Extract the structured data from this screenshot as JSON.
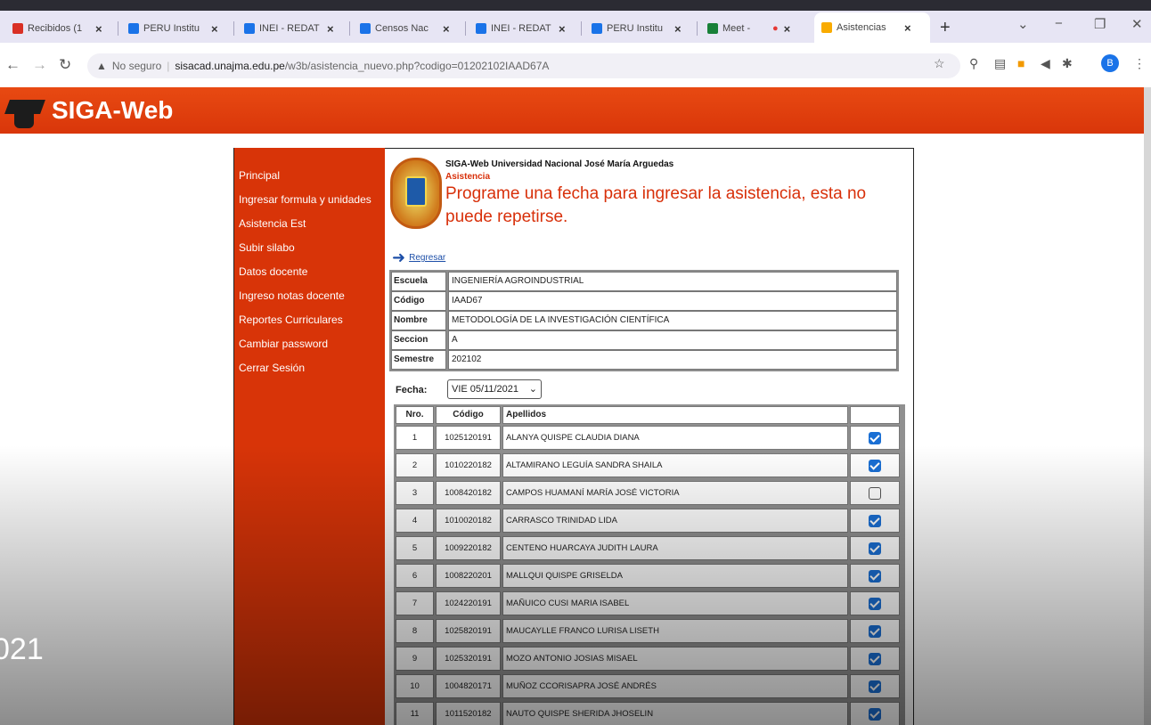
{
  "browser": {
    "tabs": [
      {
        "label": "Recibidos (1",
        "color": "#d93025"
      },
      {
        "label": "PERU Institu",
        "color": "#1a73e8"
      },
      {
        "label": "INEI - REDAT",
        "color": "#1a73e8"
      },
      {
        "label": "Censos Nac",
        "color": "#1a73e8"
      },
      {
        "label": "INEI - REDAT",
        "color": "#1a73e8"
      },
      {
        "label": "PERU Institu",
        "color": "#1a73e8"
      },
      {
        "label": "Meet - ",
        "color": "#188038"
      },
      {
        "label": "Asistencias",
        "color": "#f9ab00"
      }
    ],
    "url_warning": "No seguro",
    "url_host": "sisacad.unajma.edu.pe",
    "url_path": "/w3b/asistencia_nuevo.php?codigo=01202102IAAD67A",
    "profile_initial": "B"
  },
  "app": {
    "title": "SIGA-Web",
    "accent": "#d8300a"
  },
  "menu": {
    "items": [
      "Principal",
      "Ingresar formula y unidades",
      "Asistencia Est",
      "Subir silabo",
      "Datos docente",
      "Ingreso notas docente",
      "Reportes Curriculares",
      "Cambiar password",
      "Cerrar Sesión"
    ]
  },
  "header": {
    "institution": "SIGA-Web Universidad Nacional José María Arguedas",
    "section": "Asistencia",
    "message": "Programe una fecha para ingresar la asistencia, esta no puede repetirse.",
    "back_label": "Regresar"
  },
  "course": {
    "escuela_label": "Escuela",
    "escuela": "INGENIERÍA AGROINDUSTRIAL",
    "codigo_label": "Código",
    "codigo": "IAAD67",
    "nombre_label": "Nombre",
    "nombre": "METODOLOGÍA DE LA INVESTIGACIÓN CIENTÍFICA",
    "seccion_label": "Seccion",
    "seccion": "A",
    "semestre_label": "Semestre",
    "semestre": "202102"
  },
  "fecha": {
    "label": "Fecha:",
    "value": "VIE 05/11/2021"
  },
  "table": {
    "headers": {
      "nro": "Nro.",
      "codigo": "Código",
      "apellidos": "Apellidos"
    },
    "rows": [
      {
        "nro": "1",
        "codigo": "1025120191",
        "apellidos": "ALANYA QUISPE CLAUDIA DIANA",
        "present": true
      },
      {
        "nro": "2",
        "codigo": "1010220182",
        "apellidos": "ALTAMIRANO LEGUÍA SANDRA SHAILA",
        "present": true
      },
      {
        "nro": "3",
        "codigo": "1008420182",
        "apellidos": "CAMPOS HUAMANÍ MARÍA JOSÉ VICTORIA",
        "present": false
      },
      {
        "nro": "4",
        "codigo": "1010020182",
        "apellidos": "CARRASCO TRINIDAD LIDA",
        "present": true
      },
      {
        "nro": "5",
        "codigo": "1009220182",
        "apellidos": "CENTENO HUARCAYA JUDITH LAURA",
        "present": true
      },
      {
        "nro": "6",
        "codigo": "1008220201",
        "apellidos": "MALLQUI QUISPE GRISELDA",
        "present": true
      },
      {
        "nro": "7",
        "codigo": "1024220191",
        "apellidos": "MAÑUICO CUSI MARIA ISABEL",
        "present": true
      },
      {
        "nro": "8",
        "codigo": "1025820191",
        "apellidos": "MAUCAYLLE FRANCO LURISA LISETH",
        "present": true
      },
      {
        "nro": "9",
        "codigo": "1025320191",
        "apellidos": "MOZO ANTONIO JOSIAS MISAEL",
        "present": true
      },
      {
        "nro": "10",
        "codigo": "1004820171",
        "apellidos": "MUÑOZ CCORISAPRA JOSÉ ANDRÉS",
        "present": true
      },
      {
        "nro": "11",
        "codigo": "1011520182",
        "apellidos": "NAUTO QUISPE SHERIDA JHOSELIN",
        "present": true
      }
    ]
  },
  "overlay_text": "021"
}
